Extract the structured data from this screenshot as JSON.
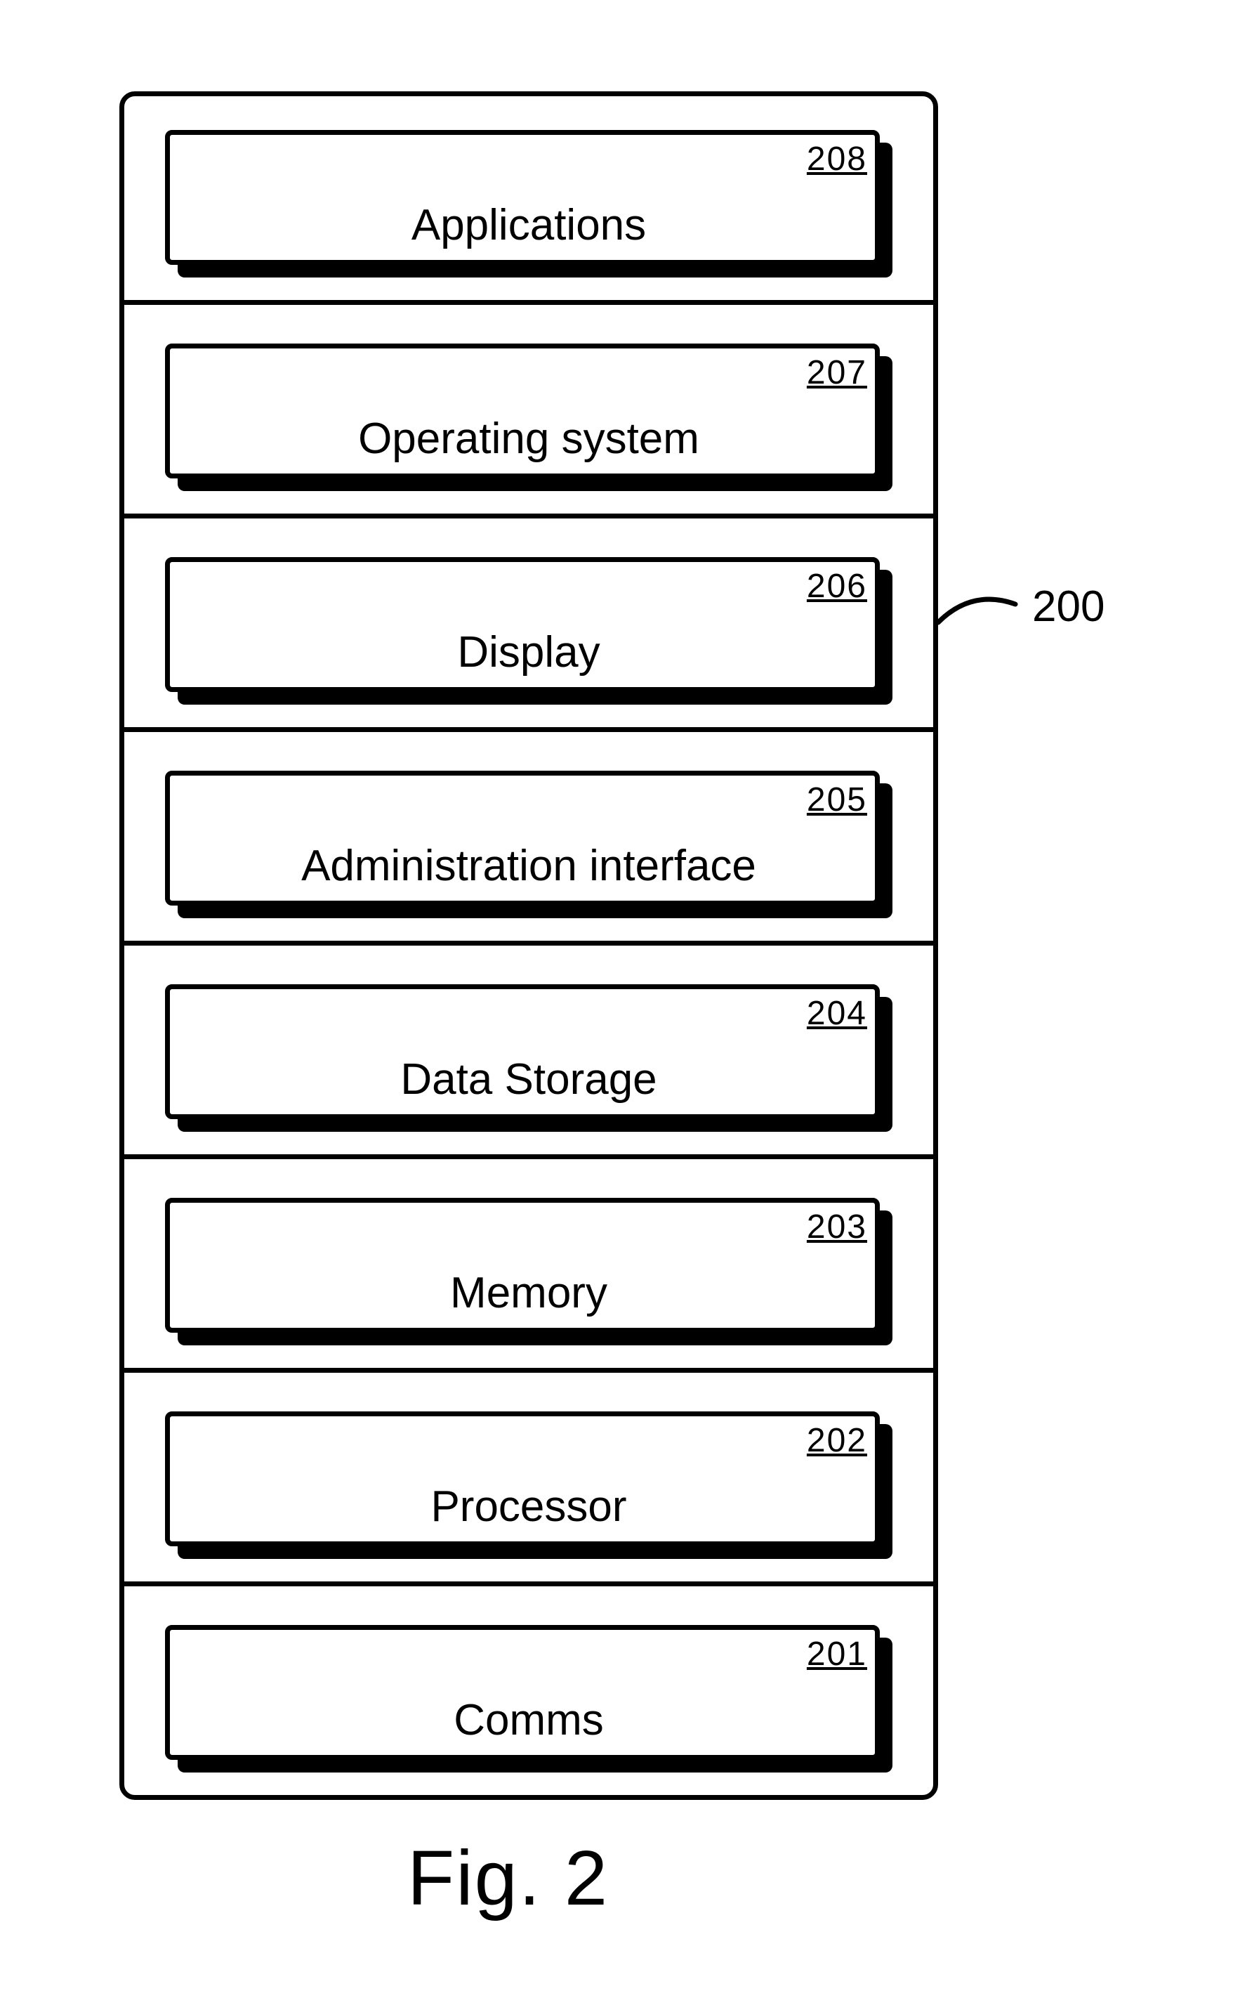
{
  "diagram": {
    "caption": "Fig. 2",
    "system_ref": "200",
    "blocks": [
      {
        "id": "applications",
        "label": "Applications",
        "ref": "208"
      },
      {
        "id": "operating-system",
        "label": "Operating system",
        "ref": "207"
      },
      {
        "id": "display",
        "label": "Display",
        "ref": "206"
      },
      {
        "id": "admin-interface",
        "label": "Administration interface",
        "ref": "205"
      },
      {
        "id": "data-storage",
        "label": "Data Storage",
        "ref": "204"
      },
      {
        "id": "memory",
        "label": "Memory",
        "ref": "203"
      },
      {
        "id": "processor",
        "label": "Processor",
        "ref": "202"
      },
      {
        "id": "comms",
        "label": "Comms",
        "ref": "201"
      }
    ]
  }
}
